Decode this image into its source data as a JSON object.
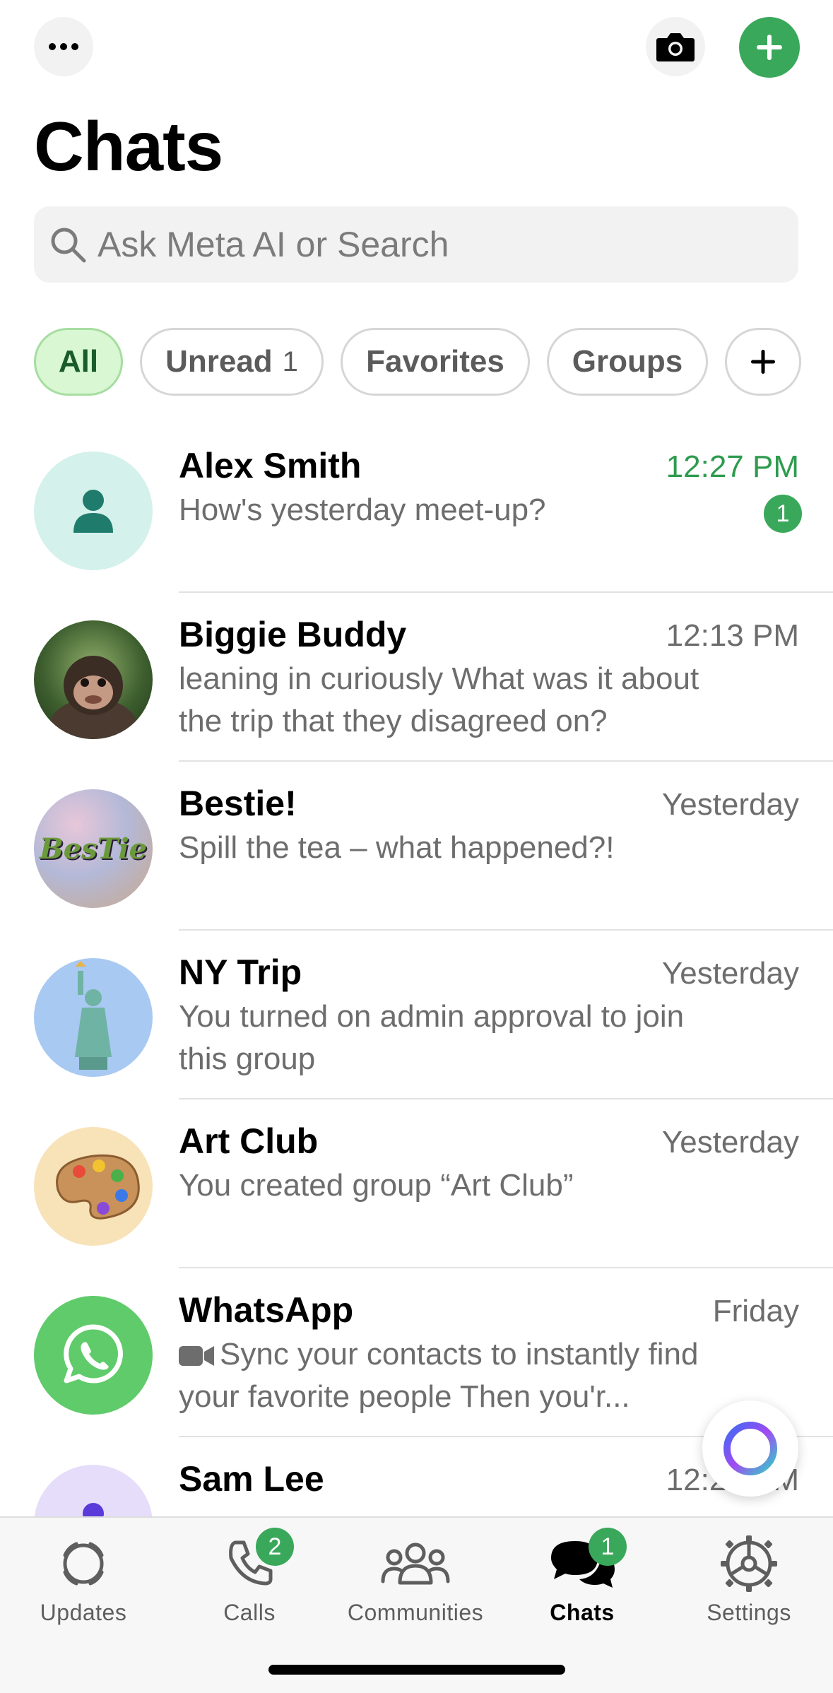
{
  "header": {
    "title": "Chats",
    "more_icon": "ellipsis-icon",
    "camera_icon": "camera-icon",
    "new_chat_icon": "plus-icon",
    "accent_color": "#3aa85a"
  },
  "search": {
    "placeholder": "Ask Meta AI or Search"
  },
  "filters": {
    "all": "All",
    "unread": "Unread",
    "unread_count": "1",
    "favorites": "Favorites",
    "groups": "Groups",
    "add": "+"
  },
  "chats": [
    {
      "name": "Alex Smith",
      "time": "12:27 PM",
      "message": "How's yesterday meet-up?",
      "unread": "1"
    },
    {
      "name": "Biggie Buddy",
      "time": "12:13 PM",
      "message": "leaning in curiously What was it about the trip that they disagreed on?"
    },
    {
      "name": "Bestie!",
      "time": "Yesterday",
      "message": "Spill the tea – what happened?!",
      "avatar_text": "BesTie"
    },
    {
      "name": "NY Trip",
      "time": "Yesterday",
      "message": "You turned on admin approval to join this group"
    },
    {
      "name": "Art Club",
      "time": "Yesterday",
      "message": "You created group “Art Club”"
    },
    {
      "name": "WhatsApp",
      "time": "Friday",
      "message": "Sync your contacts to instantly find your favorite people Then you'r..."
    },
    {
      "name": "Sam Lee",
      "time": "12:24 PM",
      "message": ""
    }
  ],
  "tabs": [
    {
      "label": "Updates",
      "icon": "updates-icon"
    },
    {
      "label": "Calls",
      "icon": "phone-icon",
      "badge": "2"
    },
    {
      "label": "Communities",
      "icon": "communities-icon"
    },
    {
      "label": "Chats",
      "icon": "chats-icon",
      "badge": "1"
    },
    {
      "label": "Settings",
      "icon": "gear-icon"
    }
  ]
}
